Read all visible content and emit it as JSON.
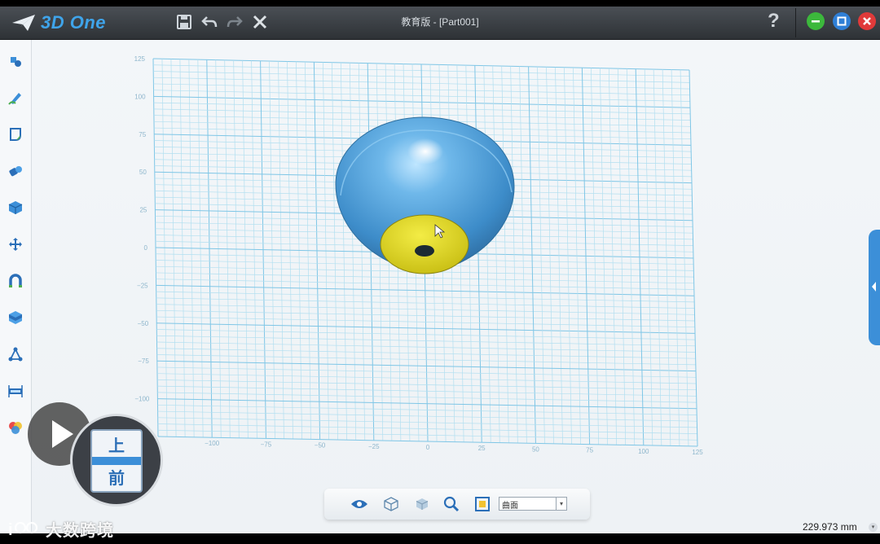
{
  "app": {
    "name": "3D One",
    "title": "教育版 - [Part001]",
    "help_label": "?"
  },
  "toolbar": {
    "icons": [
      "save-icon",
      "undo-icon",
      "redo-icon",
      "delete-icon"
    ]
  },
  "window_controls": {
    "minimize_color": "#3cb83c",
    "maximize_color": "#2f7fd6",
    "close_color": "#e03a3a"
  },
  "left_tools": [
    "basic-solid-icon",
    "sketch-icon",
    "sketch-edit-icon",
    "feature-modeling-icon",
    "special-function-icon",
    "basic-edit-icon",
    "automatic-snap-icon",
    "combine-icon",
    "distance-measure-icon",
    "ruler-icon",
    "material-render-icon"
  ],
  "grid": {
    "y_ticks": [
      "125",
      "100",
      "75",
      "50",
      "25",
      "0",
      "−25",
      "−50",
      "−75",
      "−100"
    ],
    "x_ticks": [
      "−100",
      "−75",
      "−50",
      "−25",
      "0",
      "25",
      "50",
      "75",
      "100",
      "125"
    ]
  },
  "model": {
    "body_color": "#4c9fd6",
    "face_color": "#e3dc2a"
  },
  "view_cube": {
    "top_label": "上",
    "front_label": "前"
  },
  "bottom_bar": {
    "icons": [
      "eye-icon",
      "view-cube-icon",
      "shaded-cube-icon",
      "zoom-icon",
      "fit-view-icon"
    ],
    "filter_value": "曲面"
  },
  "watermark": {
    "text": "大数跨境"
  },
  "status": {
    "readout": "229.973 mm"
  },
  "accent_color": "#3c8fd8"
}
